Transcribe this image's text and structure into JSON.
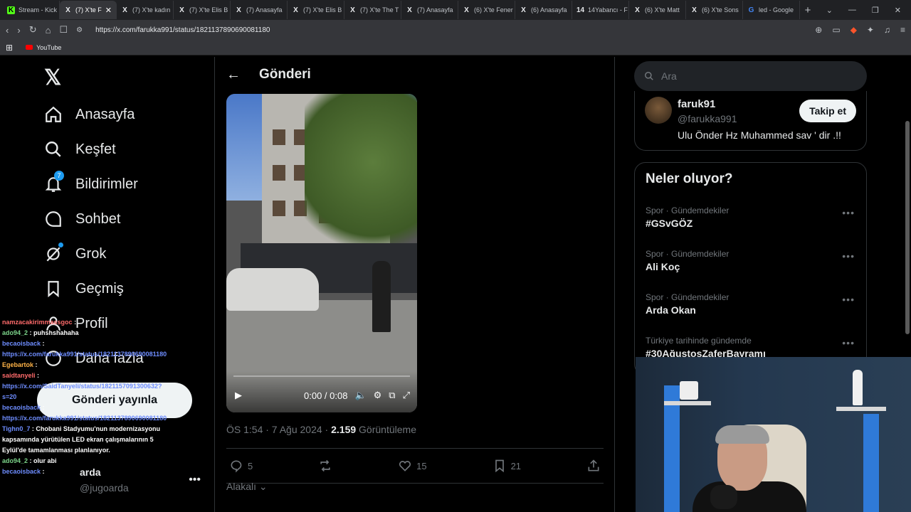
{
  "browser": {
    "tabs": [
      {
        "label": "Stream - Kick",
        "icon": "kick-icon"
      },
      {
        "label": "(7) X'te F",
        "icon": "x-icon",
        "active": true
      },
      {
        "label": "(7) X'te kadın",
        "icon": "x-icon"
      },
      {
        "label": "(7) X'te Elis B",
        "icon": "x-icon"
      },
      {
        "label": "(7) Anasayfa",
        "icon": "x-icon"
      },
      {
        "label": "(7) X'te Elis B",
        "icon": "x-icon"
      },
      {
        "label": "(7) X'te The T",
        "icon": "x-icon"
      },
      {
        "label": "(7) Anasayfa",
        "icon": "x-icon"
      },
      {
        "label": "(6) X'te Fener",
        "icon": "x-icon"
      },
      {
        "label": "(6) Anasayfa",
        "icon": "x-icon"
      },
      {
        "label": "14Yabancı - F",
        "icon": "site-icon"
      },
      {
        "label": "(6) X'te Matt",
        "icon": "x-icon"
      },
      {
        "label": "(6) X'te Sons",
        "icon": "x-icon"
      },
      {
        "label": "led - Google",
        "icon": "google-icon"
      }
    ],
    "url": "https://x.com/farukka991/status/1821137890690081180",
    "bookmark_youtube": "YouTube"
  },
  "nav": {
    "home": "Anasayfa",
    "explore": "Keşfet",
    "notifications": "Bildirimler",
    "notifications_badge": "7",
    "chat": "Sohbet",
    "grok": "Grok",
    "history": "Geçmiş",
    "profile": "Profil",
    "more": "Daha fazla",
    "post_button": "Gönderi yayınla",
    "user_name": "arda",
    "user_handle": "@jugoarda"
  },
  "chat": [
    {
      "user": "namzacakirimmassgoc",
      "color": "#ff6b6b",
      "text": ""
    },
    {
      "user": "ado94_2",
      "color": "#7bd389",
      "text": "puhshshahaha"
    },
    {
      "user": "becaoisback",
      "color": "#6e8dff",
      "text": ""
    },
    {
      "user": "",
      "color": "",
      "text": "https://x.com/farukka991/status/1821137890690081180",
      "link": true
    },
    {
      "user": "Egebartok",
      "color": "#ffb347",
      "text": ""
    },
    {
      "user": "saidtanyeli",
      "color": "#ff6b6b",
      "text": ""
    },
    {
      "user": "",
      "color": "",
      "text": "https://x.com/SaidTanyeli/status/1821157091300632?s=20",
      "link": true
    },
    {
      "user": "becaoisback",
      "color": "#6e8dff",
      "text": ""
    },
    {
      "user": "",
      "color": "",
      "text": "https://x.com/farukka991/status/1821137890690081180",
      "link": true
    },
    {
      "user": "Tighn0_7",
      "color": "#6e8dff",
      "text": "Chobani Stadyumu'nun modernizasyonu kapsamında yürütülen LED ekran çalışmalarının 5 Eylül'de tamamlanması planlanıyor."
    },
    {
      "user": "ado94_2",
      "color": "#7bd389",
      "text": "olur abi"
    },
    {
      "user": "becaoisback",
      "color": "#6e8dff",
      "text": ""
    }
  ],
  "main": {
    "header_title": "Gönderi",
    "video_time": "0:00 / 0:08",
    "video_progress": 0,
    "meta_time": "ÖS 1:54 · 7 Ağu 2024 · ",
    "meta_views": "2.159",
    "meta_views_label": " Görüntüleme",
    "replies": "5",
    "likes": "15",
    "bookmarks": "21",
    "sort_label": "Alakalı"
  },
  "sidebar": {
    "search_placeholder": "Ara",
    "profile_name": "faruk91",
    "profile_handle": "@farukka991",
    "profile_bio": "Ulu Önder Hz Muhammed sav ' dir .!!",
    "follow_label": "Takip et",
    "trends_title": "Neler oluyor?",
    "trends": [
      {
        "category": "Spor · Gündemdekiler",
        "name": "#GSvGÖZ"
      },
      {
        "category": "Spor · Gündemdekiler",
        "name": "Ali Koç"
      },
      {
        "category": "Spor · Gündemdekiler",
        "name": "Arda Okan"
      },
      {
        "category": "Türkiye tarihinde gündemde",
        "name": "#30AğustosZaferBayramı"
      }
    ]
  },
  "colors": {
    "accent": "#1d9bf0",
    "background": "#000000",
    "border": "#2f3336",
    "muted": "#71767b"
  }
}
